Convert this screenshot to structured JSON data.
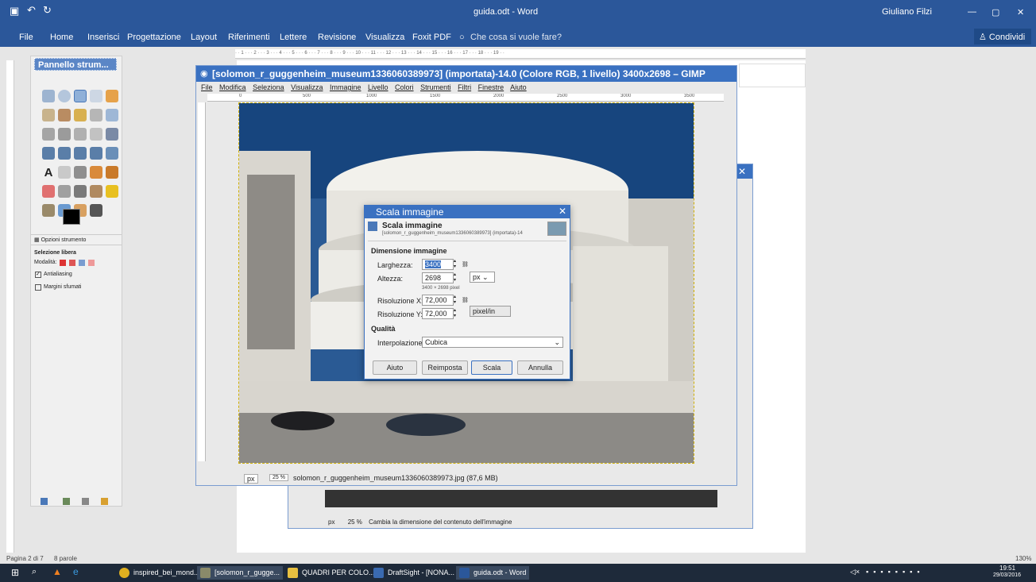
{
  "word": {
    "title": "guida.odt - Word",
    "user": "Giuliano Filzi",
    "tabs": [
      "File",
      "Home",
      "Inserisci",
      "Progettazione",
      "Layout",
      "Riferimenti",
      "Lettere",
      "Revisione",
      "Visualizza",
      "Foxit PDF"
    ],
    "tell_me": "Che cosa si vuole fare?",
    "share": "Condividi",
    "status_page": "Pagina 2 di 7",
    "status_words": "8 parole",
    "zoom": "130%"
  },
  "gimp": {
    "toolbox_title": "Pannello strum...",
    "options_tab": "Opzioni strumento",
    "options_heading": "Selezione libera",
    "mode_label": "Modalità:",
    "antialias_label": "Antialiasing",
    "feather_label": "Margini sfumati",
    "window_title": "[solomon_r_guggenheim_museum1336060389973] (importata)-14.0 (Colore RGB, 1 livello) 3400x2698 – GIMP",
    "menu": [
      "File",
      "Modifica",
      "Seleziona",
      "Visualizza",
      "Immagine",
      "Livello",
      "Colori",
      "Strumenti",
      "Filtri",
      "Finestre",
      "Aiuto"
    ],
    "ruler_marks": [
      "0",
      "500",
      "1000",
      "1500",
      "2000",
      "2500",
      "3000",
      "3500"
    ],
    "unit": "px",
    "zoom": "25 %",
    "status_text": "solomon_r_guggenheim_museum1336060389973.jpg (87,6 MB)",
    "status2_text": "Cambia la dimensione del contenuto dell'immagine"
  },
  "dialog": {
    "title": "Scala immagine",
    "header": "Scala immagine",
    "subheader": "[solomon_r_guggenheim_museum1336060389973] (importata)-14",
    "section_size": "Dimensione immagine",
    "width_label": "Larghezza:",
    "width_value": "3400",
    "height_label": "Altezza:",
    "height_value": "2698",
    "unit": "px",
    "size_note": "3400 × 2698 pixel",
    "resx_label": "Risoluzione X:",
    "resx_value": "72,000",
    "resy_label": "Risoluzione Y:",
    "resy_value": "72,000",
    "res_unit": "pixel/in",
    "section_quality": "Qualità",
    "interp_label": "Interpolazione:",
    "interp_value": "Cubica",
    "btn_help": "Aiuto",
    "btn_reset": "Reimposta",
    "btn_scale": "Scala",
    "btn_cancel": "Annulla"
  },
  "taskbar": {
    "items": [
      "inspired_bei_mond...",
      "[solomon_r_gugge...",
      "QUADRI PER COLO...",
      "DraftSight - [NONA...",
      "guida.odt - Word"
    ],
    "time": "19:51",
    "date": "29/03/2016"
  }
}
